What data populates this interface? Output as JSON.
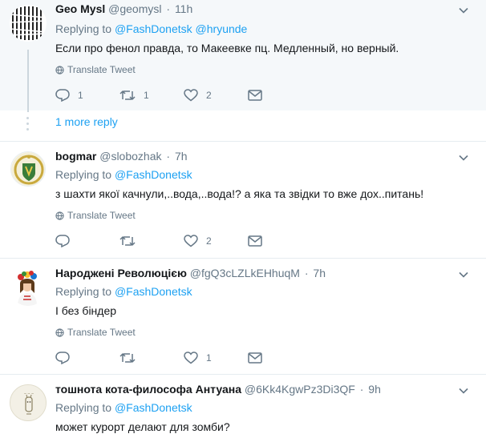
{
  "tweets": [
    {
      "name": "Geo Mysl",
      "handle": "@geomysl",
      "time": "11h",
      "replying_label": "Replying to",
      "mentions": [
        "@FashDonetsk",
        "@hryunde"
      ],
      "text": "Если про фенол правда, то Макеевке пц. Медленный, но верный.",
      "translate": "Translate Tweet",
      "replies": "1",
      "retweets": "1",
      "likes": "2"
    },
    {
      "name": "bogmar",
      "handle": "@slobozhak",
      "time": "7h",
      "replying_label": "Replying to",
      "mentions": [
        "@FashDonetsk"
      ],
      "text": "з шахти якої качнули,..вода,..вода!? а яка та звідки то вже дох..питань!",
      "translate": "Translate Tweet",
      "replies": "",
      "retweets": "",
      "likes": "2"
    },
    {
      "name": "Народжені Революцією",
      "handle": "@fgQ3cLZLkEHhuqM",
      "time": "7h",
      "replying_label": "Replying to",
      "mentions": [
        "@FashDonetsk"
      ],
      "text": "І без біндер",
      "translate": "Translate Tweet",
      "replies": "",
      "retweets": "",
      "likes": "1"
    },
    {
      "name": "тошнота кота-философа Антуана",
      "handle": "@6Kk4KgwPz3Di3QF",
      "time": "9h",
      "replying_label": "Replying to",
      "mentions": [
        "@FashDonetsk"
      ],
      "text": "может курорт делают для зомби?"
    }
  ],
  "more_reply": "1 more reply",
  "middot": "·",
  "colors": {
    "link": "#1da1f2",
    "muted": "#657786",
    "highlight_bg": "#f5f8fa",
    "border": "#e6ecf0"
  },
  "icons": [
    "chevron-down-icon",
    "globe-icon",
    "reply-icon",
    "retweet-icon",
    "heart-icon",
    "envelope-icon"
  ]
}
